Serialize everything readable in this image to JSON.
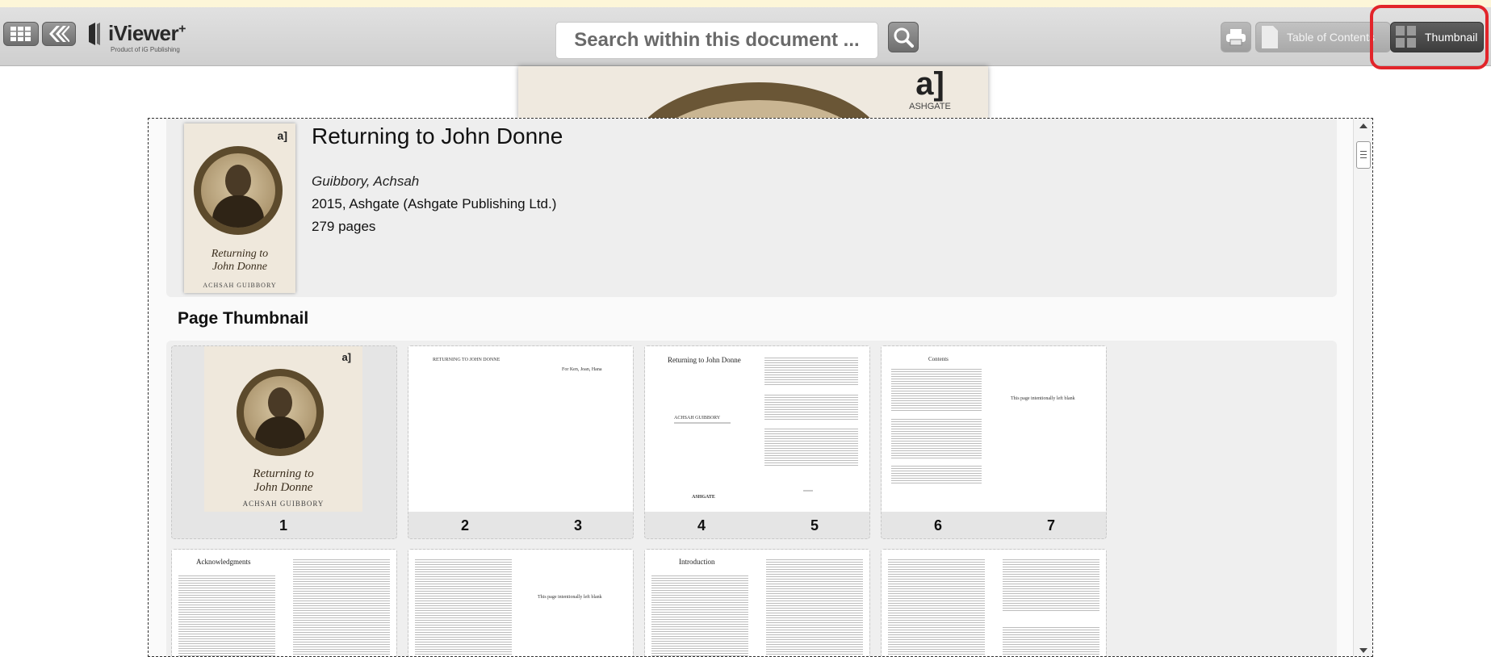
{
  "toolbar": {
    "grid_icon": "grid-menu-icon",
    "back_icon": "double-chevron-left-icon",
    "logo": {
      "name": "iViewer",
      "superscript": "+",
      "tagline": "Product of iG Publishing"
    },
    "search": {
      "placeholder": "Search within this document ..."
    },
    "search_icon": "magnifier-icon",
    "print_icon": "printer-icon",
    "toc_label": "Table of Contents",
    "thumbnail_label": "Thumbnail",
    "highlight_color": "#e2242a"
  },
  "background_cover": {
    "publisher_mark": "a]",
    "publisher": "ASHGATE"
  },
  "book": {
    "title": "Returning to John Donne",
    "author": "Guibbory, Achsah",
    "publication": "2015,  Ashgate (Ashgate Publishing Ltd.)",
    "pages": "279 pages",
    "cover": {
      "mark": "a]",
      "title_line1": "Returning to",
      "title_line2": "John Donne",
      "author": "ACHSAH GUIBBORY"
    }
  },
  "thumbnails": {
    "section_title": "Page Thumbnail",
    "row1": [
      {
        "numbers": [
          "1"
        ]
      },
      {
        "numbers": [
          "2",
          "3"
        ],
        "left_header": "RETURNING TO JOHN DONNE",
        "right_text": "For Ken, Joan, Hana"
      },
      {
        "numbers": [
          "4",
          "5"
        ],
        "left_title": "Returning to John Donne",
        "left_sub": "ACHSAH GUIBBORY",
        "left_footer": "ASHGATE"
      },
      {
        "numbers": [
          "6",
          "7"
        ],
        "left_title": "Contents",
        "right_text": "This page intentionally left blank"
      }
    ],
    "row2": [
      {
        "left_title": "Acknowledgments"
      },
      {
        "right_text": "This page intentionally left blank"
      },
      {
        "left_title": "Introduction"
      },
      {
        "left_title": ""
      }
    ]
  }
}
